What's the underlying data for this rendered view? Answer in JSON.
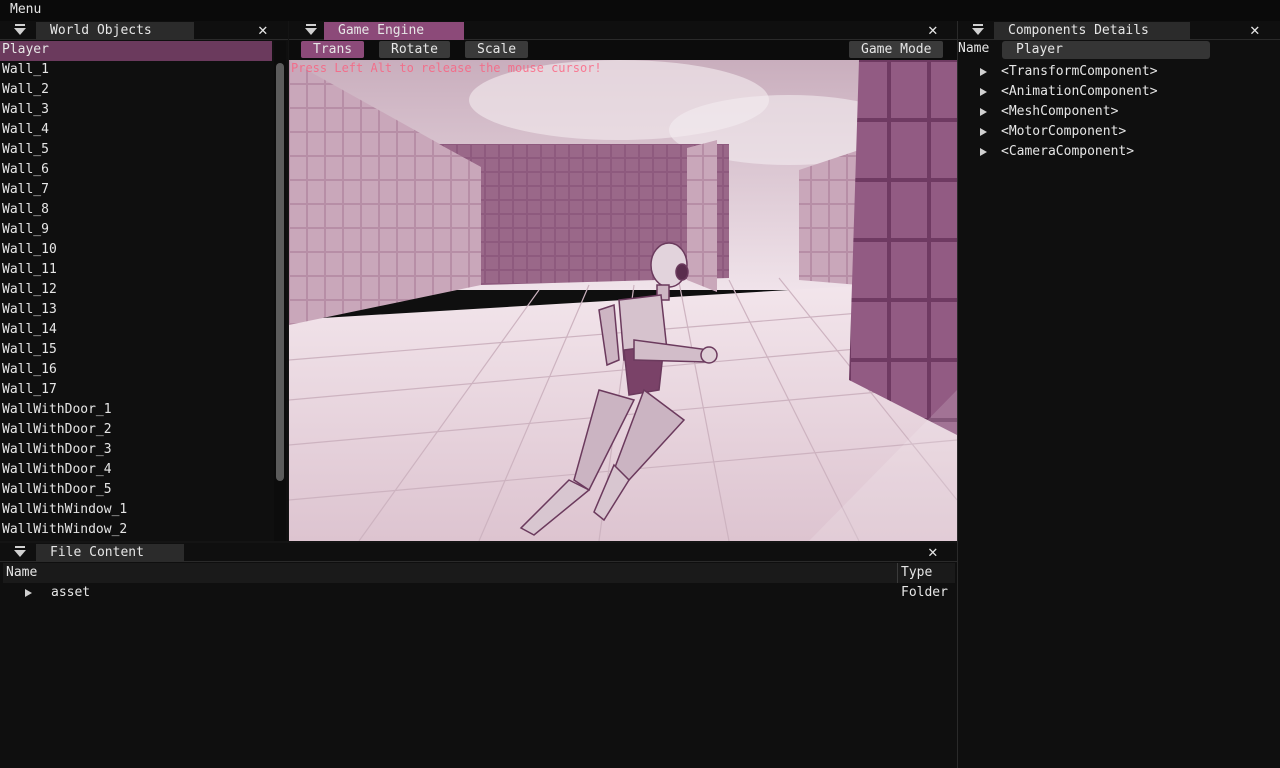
{
  "menubar": {
    "label": "Menu"
  },
  "world_objects": {
    "title": "World Objects",
    "close": "✕",
    "items": [
      "Player",
      "Wall_1",
      "Wall_2",
      "Wall_3",
      "Wall_4",
      "Wall_5",
      "Wall_6",
      "Wall_7",
      "Wall_8",
      "Wall_9",
      "Wall_10",
      "Wall_11",
      "Wall_12",
      "Wall_13",
      "Wall_14",
      "Wall_15",
      "Wall_16",
      "Wall_17",
      "WallWithDoor_1",
      "WallWithDoor_2",
      "WallWithDoor_3",
      "WallWithDoor_4",
      "WallWithDoor_5",
      "WallWithWindow_1",
      "WallWithWindow_2"
    ],
    "selected": "Player"
  },
  "game_engine": {
    "title": "Game Engine",
    "close": "✕",
    "tools": {
      "trans": "Trans",
      "rotate": "Rotate",
      "scale": "Scale"
    },
    "active_tool": "Trans",
    "mode_button": "Game Mode",
    "hint": "Press Left Alt to release the mouse cursor!"
  },
  "components": {
    "title": "Components Details",
    "close": "✕",
    "name_label": "Name",
    "name_value": "Player",
    "items": [
      "<TransformComponent>",
      "<AnimationComponent>",
      "<MeshComponent>",
      "<MotorComponent>",
      "<CameraComponent>"
    ]
  },
  "file_content": {
    "title": "File Content",
    "close": "✕",
    "columns": {
      "name": "Name",
      "type": "Type"
    },
    "rows": [
      {
        "name": "asset",
        "type": "Folder"
      }
    ]
  },
  "colors": {
    "accent": "#8c4a79",
    "selected": "#6b3a5d",
    "background": "#0f0f0f"
  }
}
